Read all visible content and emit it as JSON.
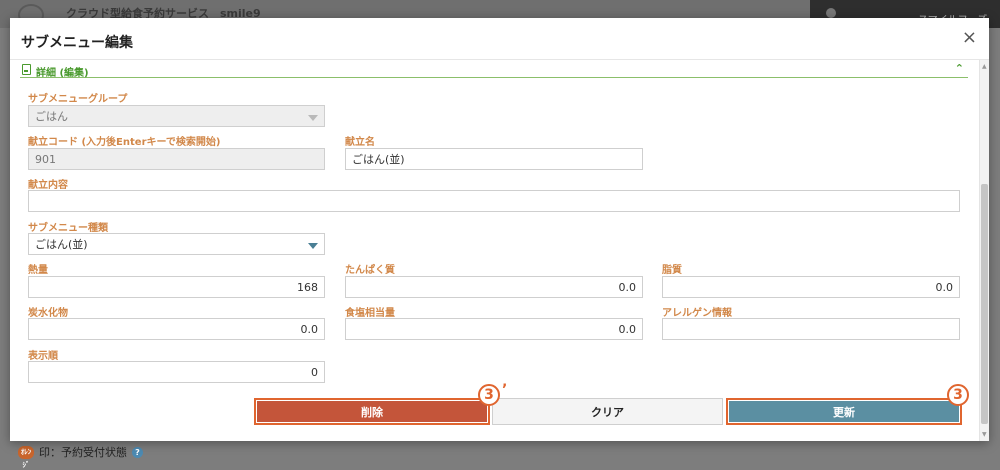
{
  "app": {
    "title": "クラウド型給食予約サービス　smile9",
    "user": "スマイルフーズ(株)"
  },
  "footer": {
    "badge": "ｵﾚﾝｼﾞ",
    "text": "印：予約受付状態",
    "help": "?"
  },
  "modal": {
    "title": "サブメニュー編集",
    "close_icon": "×",
    "section": {
      "title": "詳細 (編集)"
    },
    "fields": {
      "submenu_group": {
        "label": "サブメニューグループ",
        "value": "ごはん"
      },
      "menu_code": {
        "label": "献立コード (入力後Enterキーで検索開始)",
        "value": "901"
      },
      "menu_name": {
        "label": "献立名",
        "value": "ごはん(並)"
      },
      "menu_content": {
        "label": "献立内容",
        "value": ""
      },
      "submenu_type": {
        "label": "サブメニュー種類",
        "value": "ごはん(並)"
      },
      "calories": {
        "label": "熱量",
        "value": "168"
      },
      "protein": {
        "label": "たんぱく質",
        "value": "0.0"
      },
      "fat": {
        "label": "脂質",
        "value": "0.0"
      },
      "carbs": {
        "label": "炭水化物",
        "value": "0.0"
      },
      "salt": {
        "label": "食塩相当量",
        "value": "0.0"
      },
      "allergy": {
        "label": "アレルゲン情報",
        "value": ""
      },
      "display_order": {
        "label": "表示順",
        "value": "0"
      }
    },
    "buttons": {
      "delete": "削除",
      "clear": "クリア",
      "update": "更新"
    },
    "callouts": {
      "delete": "3",
      "delete_prime": "’",
      "update": "3"
    }
  },
  "colors": {
    "accent_orange": "#e0652f",
    "label_orange": "#d2884a",
    "section_green": "#4a9a2e",
    "delete_red": "#c4553a",
    "update_blue": "#5b8fa2"
  },
  "icons": {
    "close": "close-icon",
    "section": "document-edit-icon",
    "collapse": "chevron-up-icon",
    "dropdown": "caret-down-icon"
  }
}
